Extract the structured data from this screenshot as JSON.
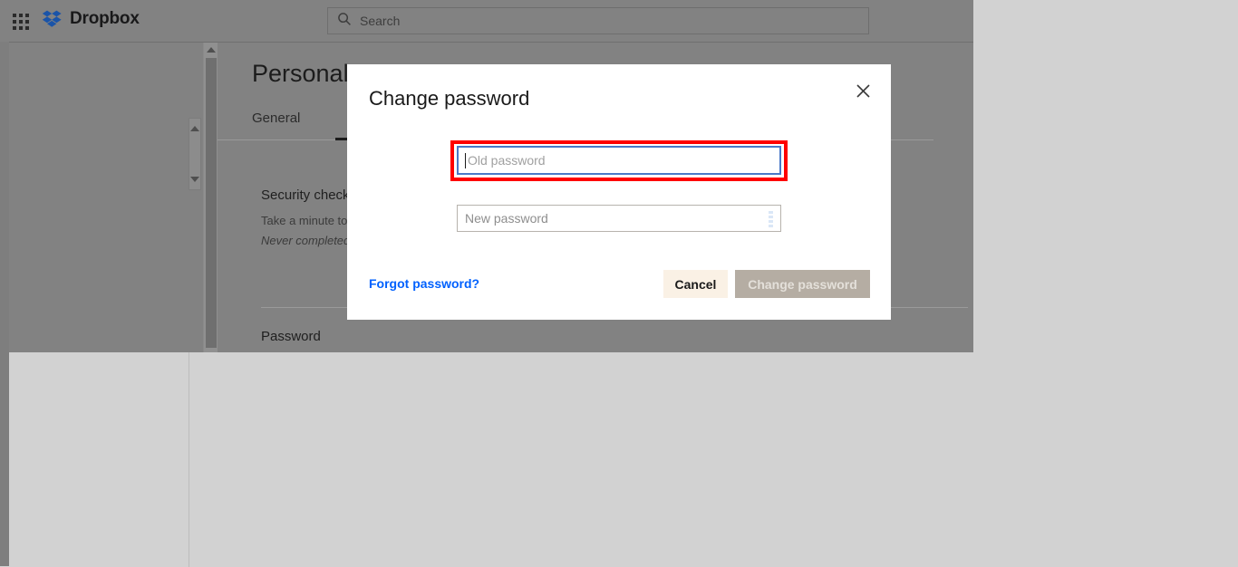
{
  "topbar": {
    "grid_icon": "apps-grid-icon",
    "brand_name": "Dropbox",
    "brand_logo_icon": "dropbox-logo-icon",
    "search": {
      "icon": "search-icon",
      "placeholder": "Search",
      "value": ""
    }
  },
  "app": {
    "page_title": "Personal",
    "tabs": [
      {
        "label": "General",
        "active": true
      }
    ],
    "sections": {
      "security": {
        "heading": "Security checkup",
        "description": "Take a minute to review your security settings",
        "status": "Never completed"
      },
      "password": {
        "heading": "Password"
      }
    }
  },
  "modal": {
    "title": "Change password",
    "close_icon": "close-icon",
    "fields": {
      "old_password": {
        "placeholder": "Old password",
        "value": "",
        "focused": true,
        "highlight_color": "#ff0000",
        "focus_ring_color": "#4a79c8"
      },
      "new_password": {
        "placeholder": "New password",
        "value": "",
        "strength_meter_icon": "password-strength-icon",
        "strength_segments": 4,
        "strength_color": "#dae7f7"
      }
    },
    "forgot_password_label": "Forgot password?",
    "forgot_password_color": "#0061fe",
    "cancel_label": "Cancel",
    "cancel_color": "#faf1e5",
    "submit_label": "Change password",
    "submit_color": "#b5ada3",
    "submit_disabled": true
  },
  "scrollbars": {
    "outer": "vertical-scrollbar-outer",
    "inner": "vertical-scrollbar-inner"
  },
  "colors": {
    "page_background": "#d2d2d2",
    "overlay": "#828282",
    "brand_blue": "#0061fe",
    "modal_background": "#ffffff"
  }
}
